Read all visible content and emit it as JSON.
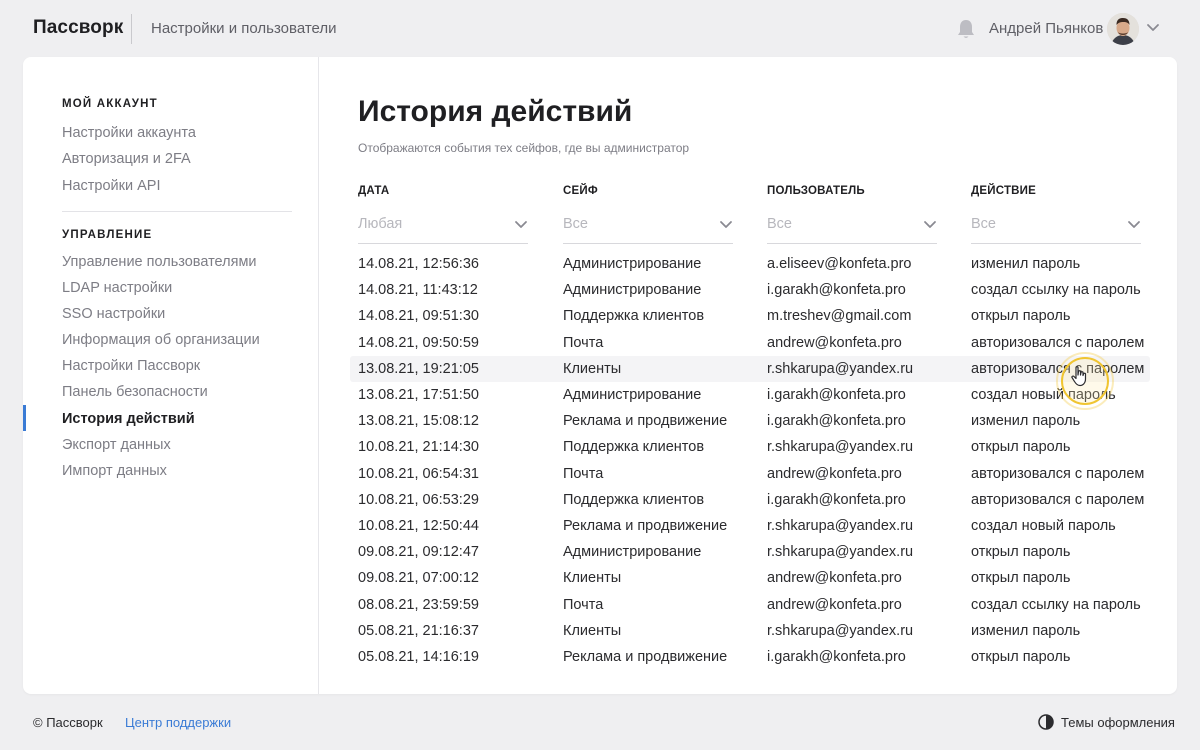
{
  "header": {
    "logo": "Пассворк",
    "section": "Настройки и пользователи",
    "user_name": "Андрей Пьянков",
    "icons": {
      "bell": "bell-icon",
      "chevron": "chevron-down-icon",
      "avatar": "user-avatar"
    }
  },
  "sidebar": {
    "account_title": "МОЙ АККАУНТ",
    "account_items": [
      {
        "label": "Настройки аккаунта"
      },
      {
        "label": "Авторизация и 2FA"
      },
      {
        "label": "Настройки API"
      }
    ],
    "management_title": "УПРАВЛЕНИЕ",
    "management_items": [
      {
        "label": "Управление пользователями"
      },
      {
        "label": "LDAP настройки"
      },
      {
        "label": "SSO настройки"
      },
      {
        "label": "Информация об организации"
      },
      {
        "label": "Настройки Пассворк"
      },
      {
        "label": "Панель безопасности"
      },
      {
        "label": "История действий",
        "active": true
      },
      {
        "label": "Экспорт данных"
      },
      {
        "label": "Импорт данных"
      }
    ],
    "accent_color": "#3a7bd5"
  },
  "main": {
    "title": "История действий",
    "subtitle": "Отображаются события тех сейфов, где вы администратор",
    "columns": [
      {
        "header": "ДАТА",
        "filter": "Любая"
      },
      {
        "header": "СЕЙФ",
        "filter": "Все"
      },
      {
        "header": "ПОЛЬЗОВАТЕЛЬ",
        "filter": "Все"
      },
      {
        "header": "ДЕЙСТВИЕ",
        "filter": "Все"
      }
    ],
    "rows": [
      {
        "date": "14.08.21, 12:56:36",
        "safe": "Администрирование",
        "user": "a.eliseev@konfeta.pro",
        "action": "изменил пароль"
      },
      {
        "date": "14.08.21, 11:43:12",
        "safe": "Администрирование",
        "user": "i.garakh@konfeta.pro",
        "action": "создал ссылку на пароль"
      },
      {
        "date": "14.08.21, 09:51:30",
        "safe": "Поддержка клиентов",
        "user": "m.treshev@gmail.com",
        "action": "открыл пароль"
      },
      {
        "date": "14.08.21, 09:50:59",
        "safe": "Почта",
        "user": "andrew@konfeta.pro",
        "action": "авторизовался с паролем"
      },
      {
        "date": "13.08.21, 19:21:05",
        "safe": "Клиенты",
        "user": "r.shkarupa@yandex.ru",
        "action": "авторизовался с паролем",
        "hovered": true
      },
      {
        "date": "13.08.21, 17:51:50",
        "safe": "Администрирование",
        "user": "i.garakh@konfeta.pro",
        "action": "создал новый пароль"
      },
      {
        "date": "13.08.21, 15:08:12",
        "safe": "Реклама и продвижение",
        "user": "i.garakh@konfeta.pro",
        "action": "изменил пароль"
      },
      {
        "date": "10.08.21, 21:14:30",
        "safe": "Поддержка клиентов",
        "user": "r.shkarupa@yandex.ru",
        "action": "открыл пароль"
      },
      {
        "date": "10.08.21, 06:54:31",
        "safe": "Почта",
        "user": "andrew@konfeta.pro",
        "action": "авторизовался с паролем"
      },
      {
        "date": "10.08.21, 06:53:29",
        "safe": "Поддержка клиентов",
        "user": "i.garakh@konfeta.pro",
        "action": "авторизовался с паролем"
      },
      {
        "date": "10.08.21, 12:50:44",
        "safe": "Реклама и продвижение",
        "user": "r.shkarupa@yandex.ru",
        "action": "создал новый пароль"
      },
      {
        "date": "09.08.21, 09:12:47",
        "safe": "Администрирование",
        "user": "r.shkarupa@yandex.ru",
        "action": "открыл пароль"
      },
      {
        "date": "09.08.21, 07:00:12",
        "safe": "Клиенты",
        "user": "andrew@konfeta.pro",
        "action": "открыл пароль"
      },
      {
        "date": "08.08.21, 23:59:59",
        "safe": "Почта",
        "user": "andrew@konfeta.pro",
        "action": "создал ссылку на пароль"
      },
      {
        "date": "05.08.21, 21:16:37",
        "safe": "Клиенты",
        "user": "r.shkarupa@yandex.ru",
        "action": "изменил пароль"
      },
      {
        "date": "05.08.21, 14:16:19",
        "safe": "Реклама и продвижение",
        "user": "i.garakh@konfeta.pro",
        "action": "открыл пароль"
      }
    ]
  },
  "footer": {
    "copyright": "© Пассворк",
    "support_link": "Центр поддержки",
    "theme_label": "Темы оформления",
    "link_color": "#3a7bd5"
  }
}
